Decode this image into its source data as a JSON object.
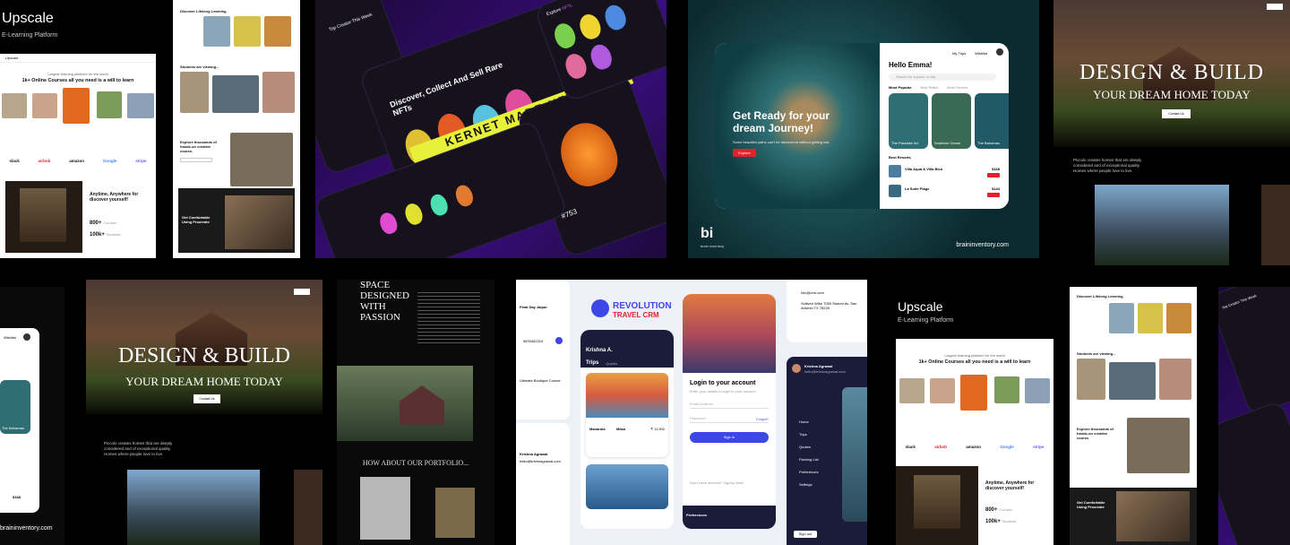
{
  "upscale": {
    "brand": "Upscale",
    "tagline": "E-Learning Platform",
    "topbar": "Upscale",
    "hero_small": "Largest learning platform for the world",
    "hero": "1k+ Online Courses all you need is a will to learn",
    "partners": [
      "slack",
      "airbnb",
      "amazon",
      "Google",
      "stripe"
    ],
    "anytime": "Anytime, Anywhere for discover yourself!",
    "stat1": "800+",
    "stat1_label": "Courses",
    "stat2": "100k+",
    "stat2_label": "Students"
  },
  "lifelong": {
    "title": "Discover Lifelong Learning",
    "viewing": "Students are viewing...",
    "explore": "Explore thousands of hands-on creative course.",
    "comfort": "Get Comfortable Using Procreate"
  },
  "nft": {
    "title": "Discover, Collect And Sell Rare NFTs",
    "top": "Top Creator This Week",
    "explore": "Explore",
    "nfts": "NFTs",
    "ribbon": "KERNET MADE NFT INT",
    "id": "#753"
  },
  "travel": {
    "hero": "Get Ready for your dream Journey!",
    "sub": "Some beautiful paths can't be discovered without getting lost.",
    "explore": "Explore",
    "greet": "Hello Emma!",
    "search": "Search for a place or city",
    "tabs": [
      "Most Popular",
      "Best Rated",
      "Most Viewed"
    ],
    "places": [
      "The Paradise Inn",
      "Southern Ocean",
      "The Bahamas"
    ],
    "best": "Best Resorts",
    "resorts": [
      {
        "name": "Villa Aqua & Villa Bleu",
        "price": "$168"
      },
      {
        "name": "La Suite Plage",
        "price": "$144"
      }
    ],
    "nav": [
      "My Trips",
      "Wishlist"
    ],
    "brand": "brain inventory",
    "url": "braininventory.com",
    "logo": "bi",
    "logo_sub": "brain inventory"
  },
  "home": {
    "line1": "DESIGN & BUILD",
    "line2": "YOUR DREAM HOME TODAY",
    "cta": "Contact Us",
    "about": "Piccolo creates homes that are deeply considered and of exceptional quality. Homes where people love to live.",
    "space": "SPACE DESIGNED WITH PASSION",
    "portfolio": "HOW ABOUT OUR PORTFOLIO..."
  },
  "crm": {
    "brand": "REVOLUTION",
    "brand2": "TRAVEL CRM",
    "user": "Krishna A.",
    "trips": "Trips",
    "quotes": "Quotes",
    "dest1": "Manarola",
    "dest1b": "Milan",
    "price1": "₹ 11,592",
    "login": "Login to your account",
    "login_sub": "Enter your details to login to your account",
    "email": "Email Address",
    "password": "Password",
    "forgot": "Forgot?",
    "signin": "Sign In",
    "signup": "Don't have account? Signup Now!",
    "profile": "Krishna Agrawal",
    "profile_email": "hello@krishnagrawal.com",
    "menu": [
      "Home",
      "Trips",
      "Quotes",
      "Packing List",
      "Preferences",
      "Settings"
    ],
    "signout": "Sign out",
    "prefs": "Preferences",
    "url": "info@crm.com",
    "addr": "Sulliven Wike 7050 Stutum Av. San Antonio TX 78225",
    "day": "Final Day Jaipur",
    "phone": "9876452210",
    "desc": "Ultimate Boutique Course",
    "name2": "Krishna Agrawal",
    "email2": "hello@krishnagrawal.com"
  },
  "colors": {
    "accent_red": "#e4202d",
    "nft_purple": "#6b1fd6",
    "nft_yellow": "#e8f13a",
    "crm_blue": "#3d47e6"
  }
}
